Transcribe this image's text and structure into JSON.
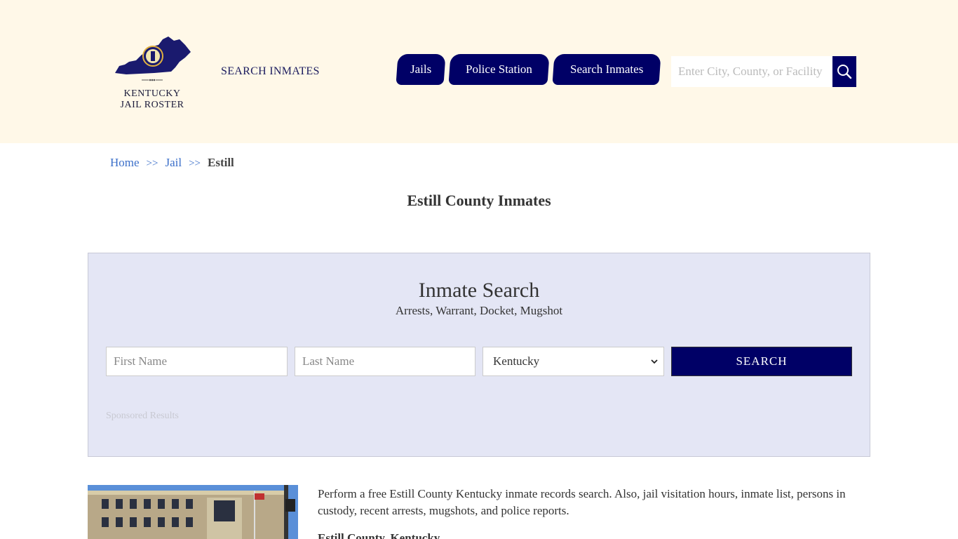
{
  "header": {
    "logo_line1": "KENTUCKY",
    "logo_line2": "JAIL ROSTER",
    "search_link": "SEARCH INMATES",
    "nav": [
      {
        "label": "Jails"
      },
      {
        "label": "Police Station"
      },
      {
        "label": "Search Inmates"
      }
    ],
    "search_placeholder": "Enter City, County, or Facility"
  },
  "breadcrumb": {
    "home": "Home",
    "sep": ">>",
    "jail": "Jail",
    "current": "Estill"
  },
  "page_title": "Estill County Inmates",
  "search_panel": {
    "title": "Inmate Search",
    "subtitle": "Arrests, Warrant, Docket, Mugshot",
    "first_name_placeholder": "First Name",
    "last_name_placeholder": "Last Name",
    "state_selected": "Kentucky",
    "submit_label": "SEARCH",
    "sponsored": "Sponsored Results"
  },
  "content": {
    "intro": "Perform a free Estill County Kentucky inmate records search. Also, jail visitation hours, inmate list, persons in custody, recent arrests, mugshots, and police reports.",
    "sub_heading": "Estill County, Kentucky"
  },
  "colors": {
    "header_bg": "#fff8e8",
    "navy": "#000066",
    "panel_bg": "#e4e6f5",
    "link": "#3b6fc9"
  }
}
